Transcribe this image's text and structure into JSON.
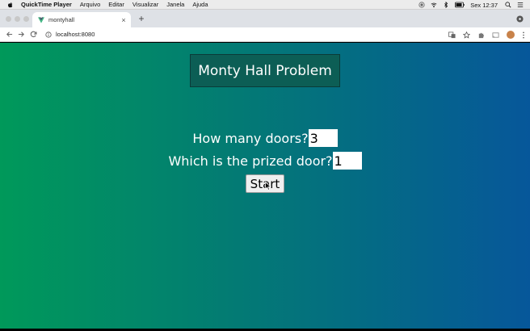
{
  "menubar": {
    "app_name": "QuickTime Player",
    "items": [
      "Arquivo",
      "Editar",
      "Visualizar",
      "Janela",
      "Ajuda"
    ],
    "clock": "Sex 12:37",
    "icons": [
      "apple-icon",
      "record-icon",
      "wifi-icon",
      "bluetooth-icon",
      "battery-icon",
      "spotlight-icon",
      "notification-center-icon"
    ]
  },
  "browser": {
    "tab": {
      "title": "montyhall",
      "favicon": "vue-logo-icon",
      "close": "×"
    },
    "new_tab": "+",
    "url": "localhost:8080"
  },
  "page": {
    "title": "Monty Hall Problem",
    "doors_question": "How many doors?",
    "doors_value": "3",
    "prize_question": "Which is the prized door?",
    "prize_value": "1",
    "start_label": "Start"
  },
  "colors": {
    "gradient_left": "#00995a",
    "gradient_right": "#06579a",
    "title_box": "#0c5e55"
  }
}
